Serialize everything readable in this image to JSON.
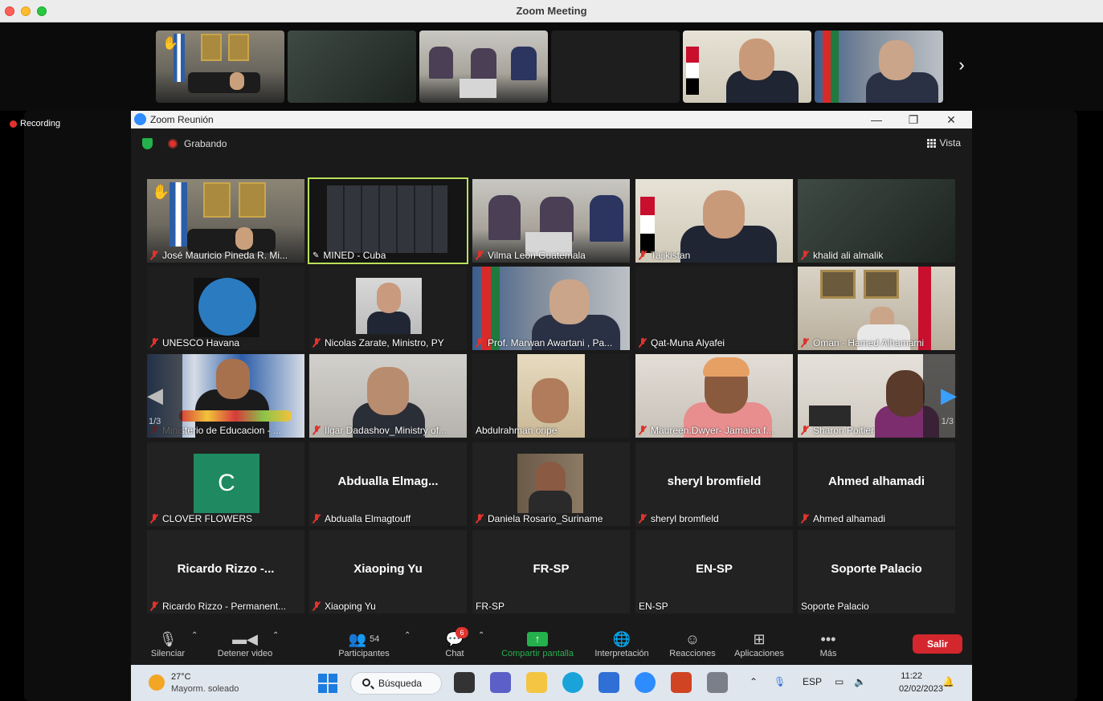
{
  "window": {
    "title": "Zoom Meeting"
  },
  "recording_label": "Recording",
  "inner_window": {
    "title": "Zoom Reunión",
    "minimize": "—",
    "maximize": "❐",
    "close": "✕"
  },
  "header": {
    "recording_status": "Grabando",
    "view_label": "Vista"
  },
  "thumbnail_strip": {
    "next_icon": "chevron-right-icon"
  },
  "gallery": {
    "page_left": "1/3",
    "page_right": "1/3",
    "tiles": [
      {
        "name": "José Mauricio Pineda R. Mi...",
        "muted": true,
        "hand": true
      },
      {
        "name": "MINED - Cuba",
        "muted": false,
        "active": true
      },
      {
        "name": "Vilma León Guatemala",
        "muted": true
      },
      {
        "name": "Tajikistan",
        "muted": true
      },
      {
        "name": "khalid ali almalik",
        "muted": true
      },
      {
        "name": "UNESCO Havana",
        "muted": true
      },
      {
        "name": "Nicolas Zarate, Ministro, PY",
        "muted": true
      },
      {
        "name": "Prof. Marwan Awartani , Pa...",
        "muted": true
      },
      {
        "name": "Qat-Muna Alyafei",
        "muted": true
      },
      {
        "name": "Oman - Hamed Alhamami",
        "muted": true
      },
      {
        "name": "Ministerio de Educacion - ...",
        "muted": true
      },
      {
        "name": "Ilgar Dadashov_Ministry of...",
        "muted": true
      },
      {
        "name": "Abdulrahman oripe",
        "muted": false
      },
      {
        "name": "Maureen.Dwyer- Jamaica f...",
        "muted": true
      },
      {
        "name": "Sharon Poitier",
        "muted": true
      },
      {
        "name": "CLOVER FLOWERS",
        "muted": true,
        "avatar_letter": "C"
      },
      {
        "name": "Abdualla Elmagtouff",
        "muted": true,
        "display": "Abdualla  Elmag..."
      },
      {
        "name": "Daniela Rosario_Suriname",
        "muted": true
      },
      {
        "name": "sheryl bromfield",
        "muted": true,
        "display": "sheryl bromfield"
      },
      {
        "name": "Ahmed alhamadi",
        "muted": true,
        "display": "Ahmed alhamadi"
      },
      {
        "name": "Ricardo Rizzo - Permanent...",
        "muted": true,
        "display": "Ricardo  Rizzo  -..."
      },
      {
        "name": "Xiaoping Yu",
        "muted": true,
        "display": "Xiaoping Yu"
      },
      {
        "name": "FR-SP",
        "muted": false,
        "display": "FR-SP"
      },
      {
        "name": "EN-SP",
        "muted": false,
        "display": "EN-SP"
      },
      {
        "name": "Soporte Palacio",
        "muted": false,
        "display": "Soporte Palacio"
      }
    ]
  },
  "toolbar": {
    "mute": "Silenciar",
    "video": "Detener video",
    "participants": "Participantes",
    "participants_count": "54",
    "chat": "Chat",
    "chat_badge": "6",
    "share": "Compartir pantalla",
    "interpretation": "Interpretación",
    "reactions": "Reacciones",
    "apps": "Aplicaciones",
    "more": "Más",
    "leave": "Salir"
  },
  "taskbar": {
    "temperature": "27°C",
    "weather": "Mayorm. soleado",
    "search": "Búsqueda",
    "language": "ESP",
    "time": "11:22",
    "date": "02/02/2023"
  },
  "colors": {
    "accent_green": "#24b14c",
    "active_border": "#b9e05a",
    "leave_red": "#d3262d",
    "muted_red": "#e0332d"
  }
}
